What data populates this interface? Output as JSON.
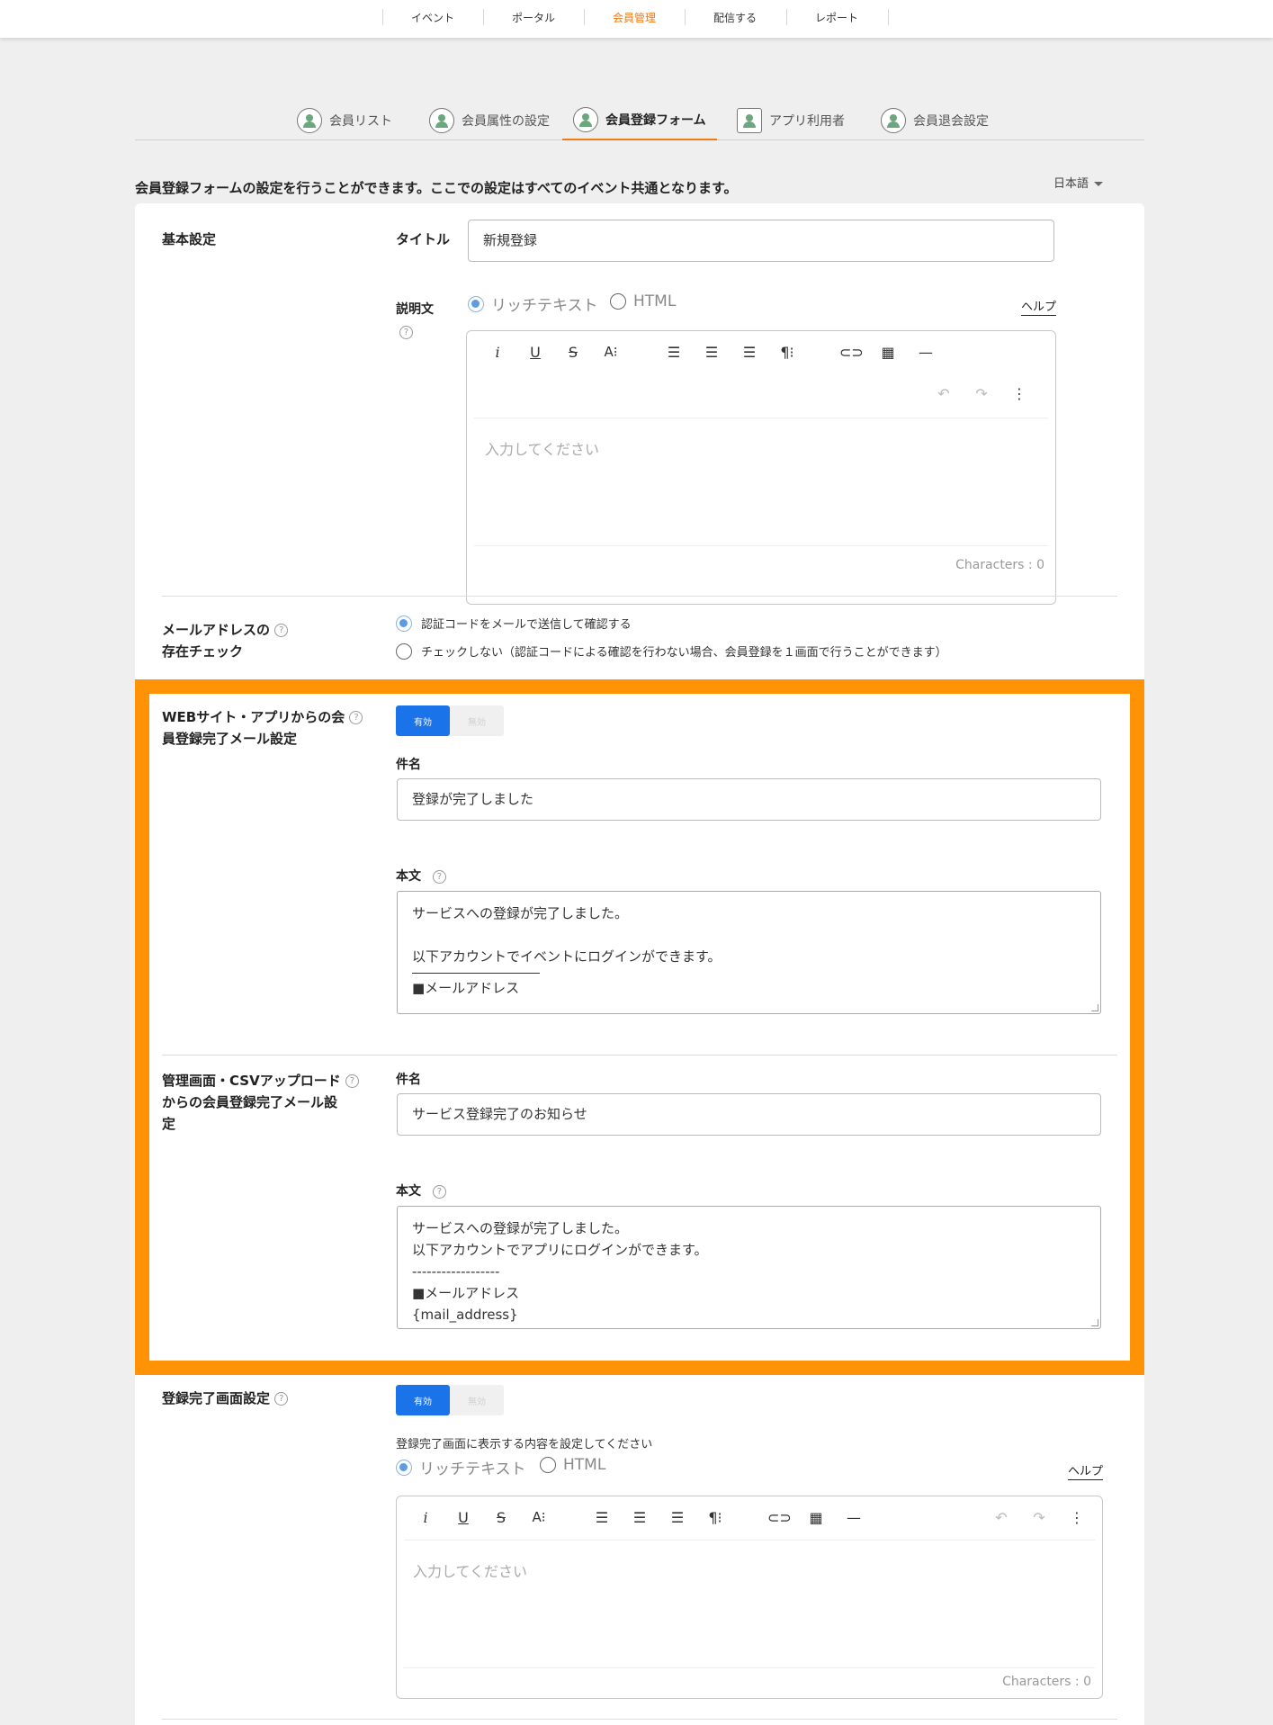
{
  "topnav": {
    "items": [
      "イベント",
      "ポータル",
      "会員管理",
      "配信する",
      "レポート"
    ],
    "active_index": 2
  },
  "subtabs": {
    "items": [
      "会員リスト",
      "会員属性の設定",
      "会員登録フォーム",
      "アプリ利用者",
      "会員退会設定"
    ],
    "active_index": 2
  },
  "intro_text": "会員登録フォームの設定を行うことができます。ここでの設定はすべてのイベント共通となります。",
  "language": "日本語",
  "basic": {
    "section_label": "基本設定",
    "title_label": "タイトル",
    "title_value": "新規登録",
    "description_label": "説明文",
    "mode_rich": "リッチテキスト",
    "mode_html": "HTML",
    "help": "ヘルプ",
    "placeholder": "入力してください",
    "chars": "Characters : 0"
  },
  "email_check": {
    "label_line1": "メールアドレスの",
    "label_line2": "存在チェック",
    "option1": "認証コードをメールで送信して確認する",
    "option2": "チェックしない（認証コードによる確認を行わない場合、会員登録を１画面で行うことができます）"
  },
  "web_mail": {
    "label_line1": "WEBサイト・アプリからの会",
    "label_line2": "員登録完了メール設定",
    "toggle_on": "有効",
    "toggle_off": "無効",
    "subject_label": "件名",
    "subject_value": "登録が完了しました",
    "body_label": "本文",
    "body_lines": [
      "サービスへの登録が完了しました。",
      "",
      "以下アカウントでイベントにログインができます。",
      "■メールアドレス"
    ]
  },
  "admin_mail": {
    "label_line1": "管理画面・CSVアップロード",
    "label_line2": "からの会員登録完了メール設",
    "label_line3": "定",
    "subject_label": "件名",
    "subject_value": "サービス登録完了のお知らせ",
    "body_label": "本文",
    "body_lines": [
      "サービスへの登録が完了しました。",
      "以下アカウントでアプリにログインができます。",
      "------------------",
      "■メールアドレス",
      "{mail_address}"
    ]
  },
  "complete_screen": {
    "label": "登録完了画面設定",
    "toggle_on": "有効",
    "toggle_off": "無効",
    "hint": "登録完了画面に表示する内容を設定してください",
    "mode_rich": "リッチテキスト",
    "mode_html": "HTML",
    "help": "ヘルプ",
    "placeholder": "入力してください",
    "chars": "Characters : 0"
  },
  "colors": {
    "accent": "#f27a12",
    "highlight": "#ff9305",
    "primary": "#1a73e8"
  }
}
